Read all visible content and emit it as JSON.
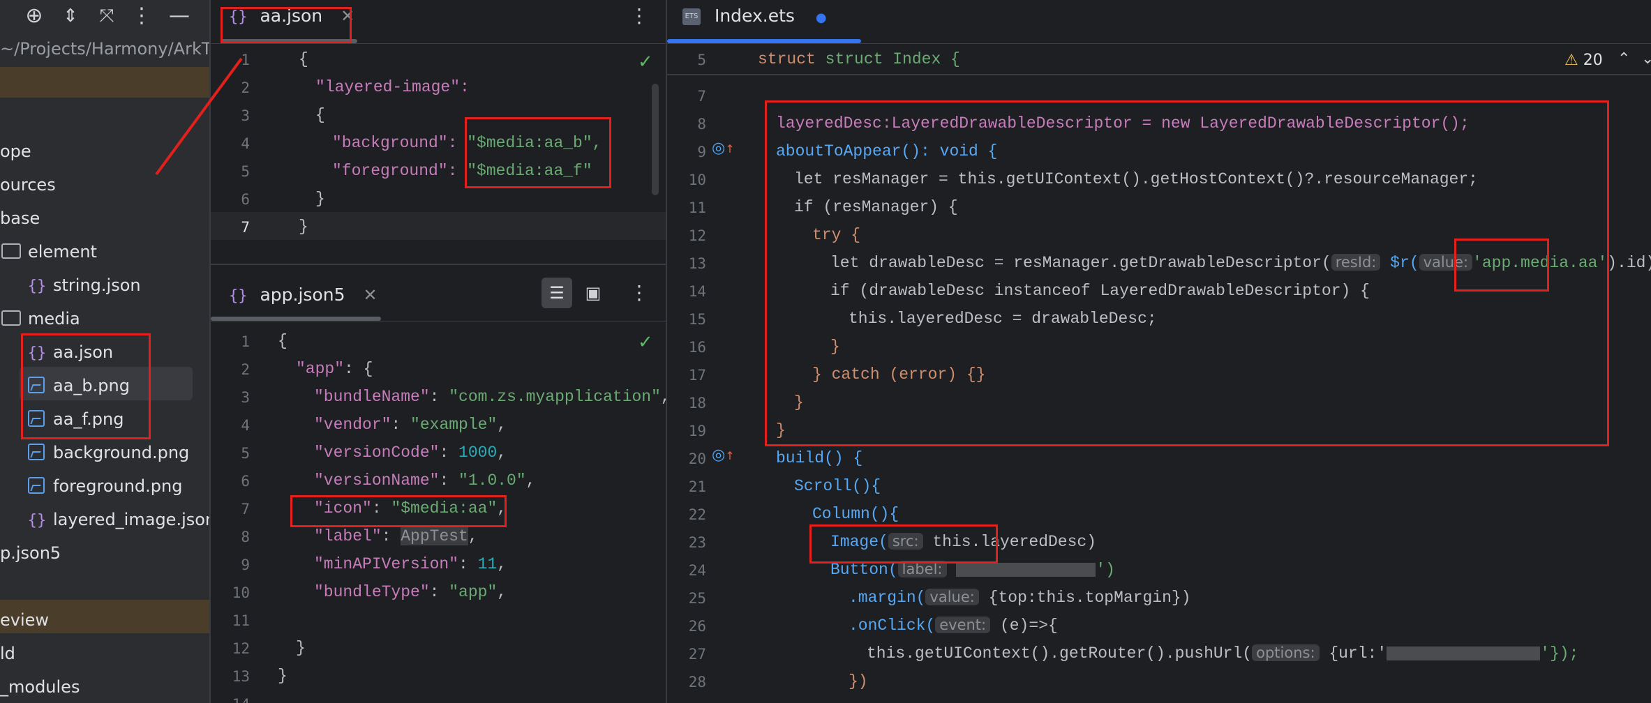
{
  "sidebar": {
    "toolbar_icons": [
      "target-icon",
      "expand-collapse-icon",
      "collapse-all-icon",
      "more-vert-icon",
      "minimize-icon"
    ],
    "path": "~/Projects/Harmony/ArkT",
    "tree": [
      {
        "label": "ope",
        "kind": "folder-partial"
      },
      {
        "label": "ources",
        "kind": "folder-partial"
      },
      {
        "label": "base",
        "kind": "folder-partial"
      },
      {
        "label": "element",
        "kind": "folder"
      },
      {
        "label": "string.json",
        "kind": "json"
      },
      {
        "label": "media",
        "kind": "folder"
      },
      {
        "label": "aa.json",
        "kind": "json"
      },
      {
        "label": "aa_b.png",
        "kind": "image"
      },
      {
        "label": "aa_f.png",
        "kind": "image"
      },
      {
        "label": "background.png",
        "kind": "image"
      },
      {
        "label": "foreground.png",
        "kind": "image"
      },
      {
        "label": "layered_image.json",
        "kind": "json"
      },
      {
        "label": "p.json5",
        "kind": "file-partial"
      },
      {
        "label": "eview",
        "kind": "partial"
      },
      {
        "label": "ld",
        "kind": "partial"
      },
      {
        "label": "_modules",
        "kind": "partial"
      }
    ]
  },
  "aa_pane": {
    "tab_label": "aa.json",
    "line_numbers": [
      "1",
      "2",
      "3",
      "4",
      "5",
      "6",
      "7"
    ],
    "lines": [
      "{",
      "\"layered-image\":",
      "{",
      "\"background\": ",
      "\"foreground\": ",
      "}",
      "}"
    ],
    "bg_value": "\"$media:aa_b\",",
    "fg_value": "\"$media:aa_f\""
  },
  "app_pane": {
    "tab_label": "app.json5",
    "line_numbers": [
      "1",
      "2",
      "3",
      "4",
      "5",
      "6",
      "7",
      "8",
      "9",
      "10",
      "11",
      "12",
      "13",
      "14"
    ],
    "l1": "{",
    "l2_key": "\"app\"",
    "l2_rest": ": {",
    "l3_key": "\"bundleName\"",
    "l3_val": "\"com.zs.myapplication\"",
    "l4_key": "\"vendor\"",
    "l4_val": "\"example\"",
    "l5_key": "\"versionCode\"",
    "l5_val": "1000",
    "l6_key": "\"versionName\"",
    "l6_val": "\"1.0.0\"",
    "l7_key": "\"icon\"",
    "l7_val": "\"$media:aa\"",
    "l8_key": "\"label\"",
    "l8_val": "AppTest",
    "l9_key": "\"minAPIVersion\"",
    "l9_val": "11",
    "l10_key": "\"bundleType\"",
    "l10_val": "\"app\"",
    "l12": "}",
    "l13": "}"
  },
  "index_pane": {
    "tab_label": "Index.ets",
    "warning_count": "20",
    "line_numbers": [
      "5",
      "",
      "7",
      "8",
      "9",
      "10",
      "11",
      "12",
      "13",
      "14",
      "15",
      "16",
      "17",
      "18",
      "19",
      "20",
      "21",
      "22",
      "23",
      "24",
      "25",
      "26",
      "27",
      "28"
    ],
    "sticky": "struct Index {",
    "l8": "layeredDesc:LayeredDrawableDescriptor = new LayeredDrawableDescriptor();",
    "l9": "aboutToAppear(): void {",
    "l10": "let resManager = this.getUIContext().getHostContext()?.resourceManager;",
    "l11": "if (resManager) {",
    "l12": "try {",
    "l13_a": "let drawableDesc = resManager.getDrawableDescriptor(",
    "l13_hint1": "resId:",
    "l13_b": "$r(",
    "l13_hint2": "value:",
    "l13_c": "'app.media.aa'",
    "l13_d": ").id);",
    "l14": "if (drawableDesc instanceof LayeredDrawableDescriptor) {",
    "l15": "this.layeredDesc = drawableDesc;",
    "l16": "}",
    "l17": "} catch (error) {}",
    "l18": "}",
    "l19": "}",
    "l20": "build() {",
    "l21": "Scroll(){",
    "l22": "Column(){",
    "l23_a": "Image(",
    "l23_hint": "src:",
    "l23_b": "this.layeredDesc)",
    "l24_a": "Button(",
    "l24_hint": "label:",
    "l24_b": "')",
    "l25_a": ".margin(",
    "l25_hint": "value:",
    "l25_b": "{top:this.topMargin})",
    "l26_a": ".onClick(",
    "l26_hint": "event:",
    "l26_b": "(e)=>{",
    "l27_a": "this.getUIContext().getRouter().pushUrl(",
    "l27_hint": "options:",
    "l27_b": "{url:'",
    "l27_c": "'});",
    "l28": "})"
  },
  "colors": {
    "annotation_red": "#e3201b",
    "accent_blue": "#3574f0"
  }
}
